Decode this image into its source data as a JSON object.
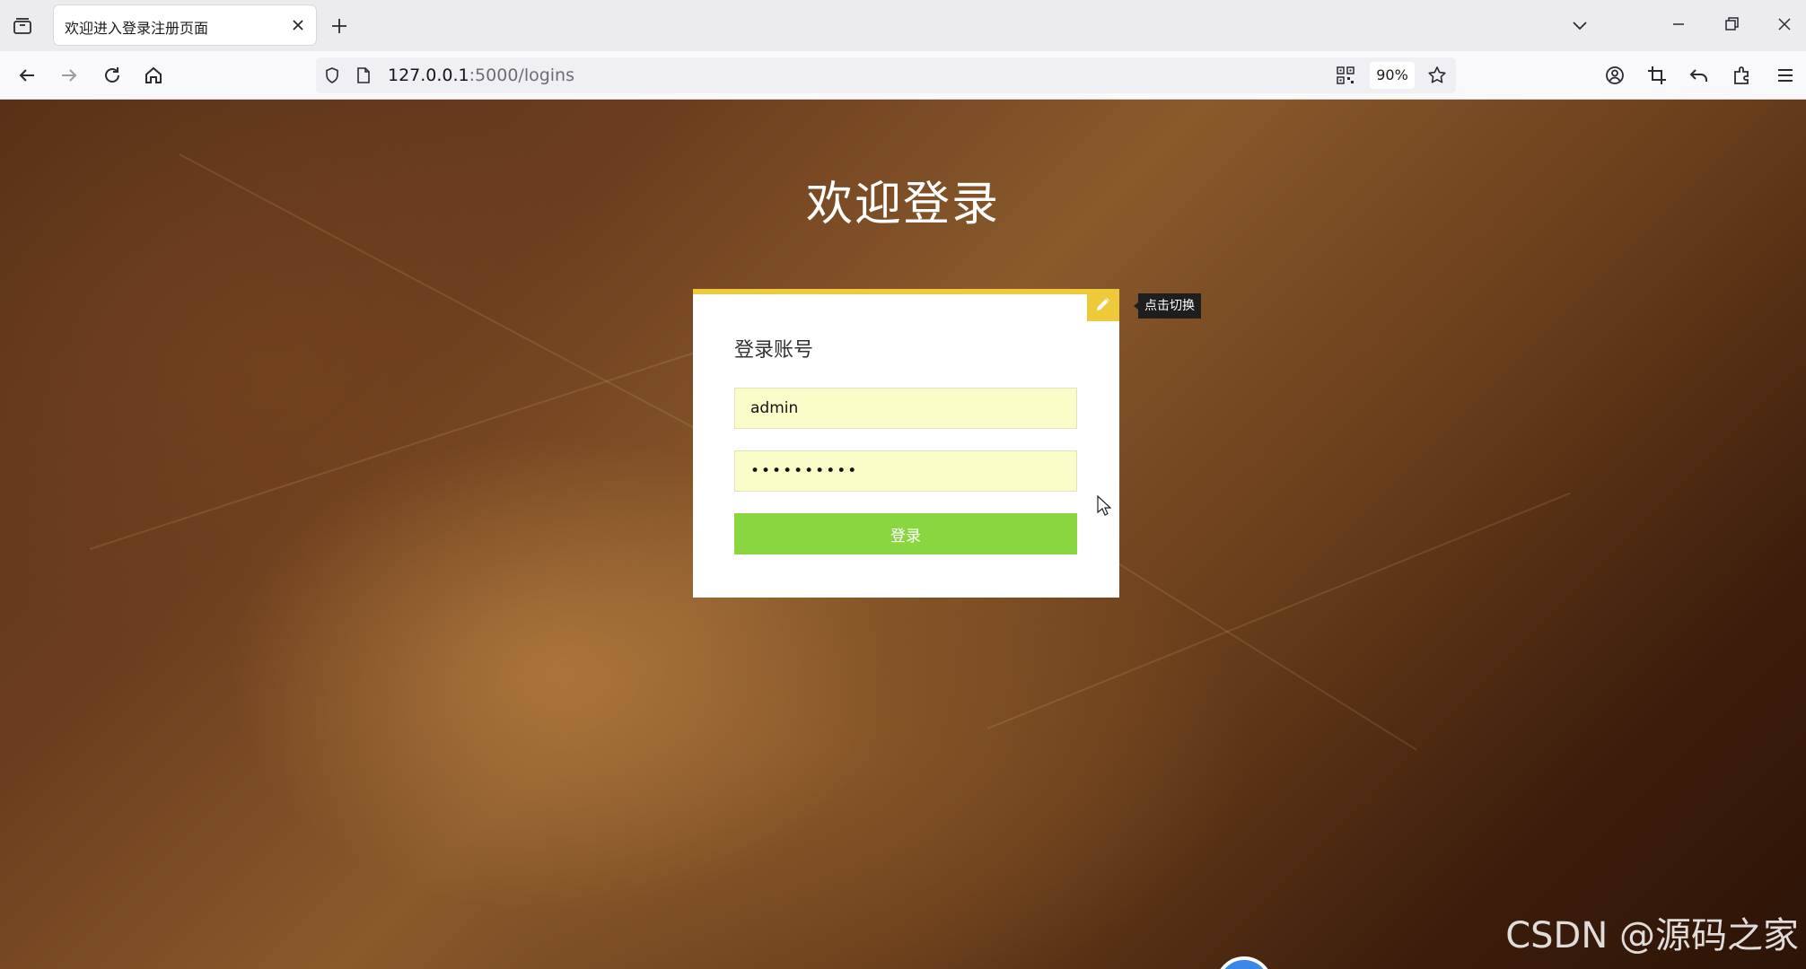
{
  "browser": {
    "tab": {
      "title": "欢迎进入登录注册页面"
    },
    "url": {
      "host": "127.0.0.1",
      "path": ":5000/logins"
    },
    "zoom": "90%"
  },
  "page": {
    "heading": "欢迎登录",
    "card": {
      "title": "登录账号",
      "username_value": "admin",
      "password_value": "••••••••••",
      "login_label": "登录",
      "toggle_tooltip": "点击切换"
    },
    "watermark": "CSDN @源码之家"
  },
  "colors": {
    "accent_yellow": "#eec93a",
    "login_green": "#8ad640",
    "field_bg": "#fbfdc9"
  }
}
